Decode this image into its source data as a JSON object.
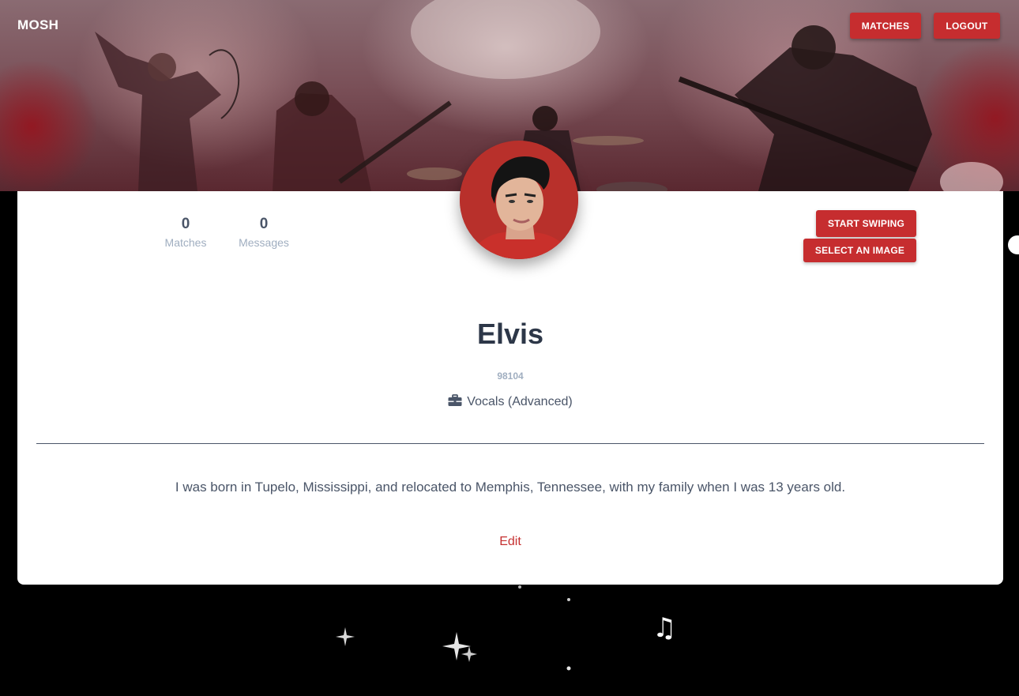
{
  "header": {
    "brand": "MOSH",
    "nav": {
      "matches_label": "MATCHES",
      "logout_label": "LOGOUT"
    }
  },
  "profile": {
    "stats": [
      {
        "value": "0",
        "label": "Matches"
      },
      {
        "value": "0",
        "label": "Messages"
      }
    ],
    "actions": {
      "start_swiping_label": "START SWIPING",
      "select_image_label": "SELECT AN IMAGE"
    },
    "name": "Elvis",
    "zip": "98104",
    "instrument": "Vocals (Advanced)",
    "instrument_icon": "briefcase-icon",
    "bio": "I was born in Tupelo, Mississippi, and relocated to Memphis, Tennessee, with my family when I was 13 years old.",
    "edit_label": "Edit"
  },
  "decor": {
    "music_note": "♫"
  },
  "colors": {
    "accent": "#c62d2f",
    "link": "#c53030",
    "heading": "#2d3748",
    "muted": "#a0aec0",
    "page_background": "#000000"
  }
}
